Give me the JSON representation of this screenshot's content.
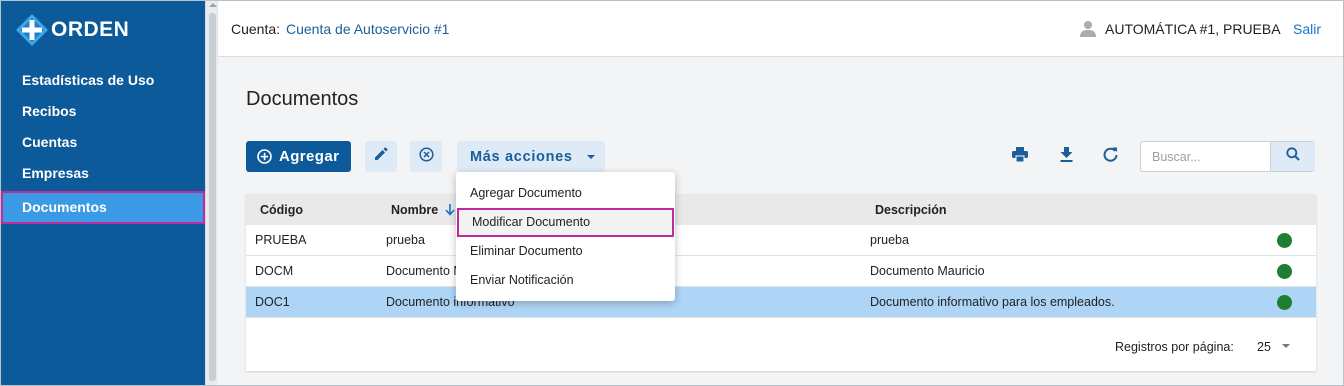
{
  "brand": {
    "name": "ORDEN",
    "logo_icon": "plus-cross-logo",
    "color": "#0d5a9a"
  },
  "sidebar": {
    "items": [
      {
        "label": "Estadísticas de Uso",
        "active": false
      },
      {
        "label": "Recibos",
        "active": false
      },
      {
        "label": "Cuentas",
        "active": false
      },
      {
        "label": "Empresas",
        "active": false
      },
      {
        "label": "Documentos",
        "active": true
      }
    ]
  },
  "header": {
    "account_label": "Cuenta:",
    "account_value": "Cuenta de Autoservicio #1",
    "user_icon": "user-icon",
    "user_name": "AUTOMÁTICA #1, PRUEBA",
    "logout": "Salir"
  },
  "main": {
    "title": "Documentos",
    "toolbar": {
      "add_label": "Agregar",
      "edit_icon": "pencil-icon",
      "cancel_icon": "circle-x-icon",
      "more_label": "Más acciones",
      "print_icon": "print-icon",
      "download_icon": "download-icon",
      "refresh_icon": "refresh-icon",
      "search_placeholder": "Buscar...",
      "search_value": "",
      "search_icon": "search-icon"
    },
    "menu": {
      "items": [
        {
          "label": "Agregar Documento",
          "highlighted": false
        },
        {
          "label": "Modificar Documento",
          "highlighted": true
        },
        {
          "label": "Eliminar Documento",
          "highlighted": false
        },
        {
          "label": "Enviar Notificación",
          "highlighted": false
        }
      ]
    },
    "table": {
      "columns": [
        "Código",
        "Nombre",
        "Descripción"
      ],
      "sort_column": "Nombre",
      "sort_direction": "descending",
      "rows": [
        {
          "code": "PRUEBA",
          "name": "prueba",
          "description": "prueba",
          "status": "active",
          "selected": false
        },
        {
          "code": "DOCM",
          "name": "Documento Mauricio",
          "description": "Documento Mauricio",
          "status": "active",
          "selected": false
        },
        {
          "code": "DOC1",
          "name": "Documento informativo",
          "description": "Documento informativo para los empleados.",
          "status": "active",
          "selected": true
        }
      ],
      "status_color": "#1e7e34",
      "selected_row_color": "#aed4f6",
      "rows_per_page_label": "Registros por página:",
      "rows_per_page_value": "25"
    }
  },
  "colors": {
    "accent": "#0d5a9a",
    "highlight_border": "#c2299b",
    "active_nav": "#3a9ae6"
  }
}
